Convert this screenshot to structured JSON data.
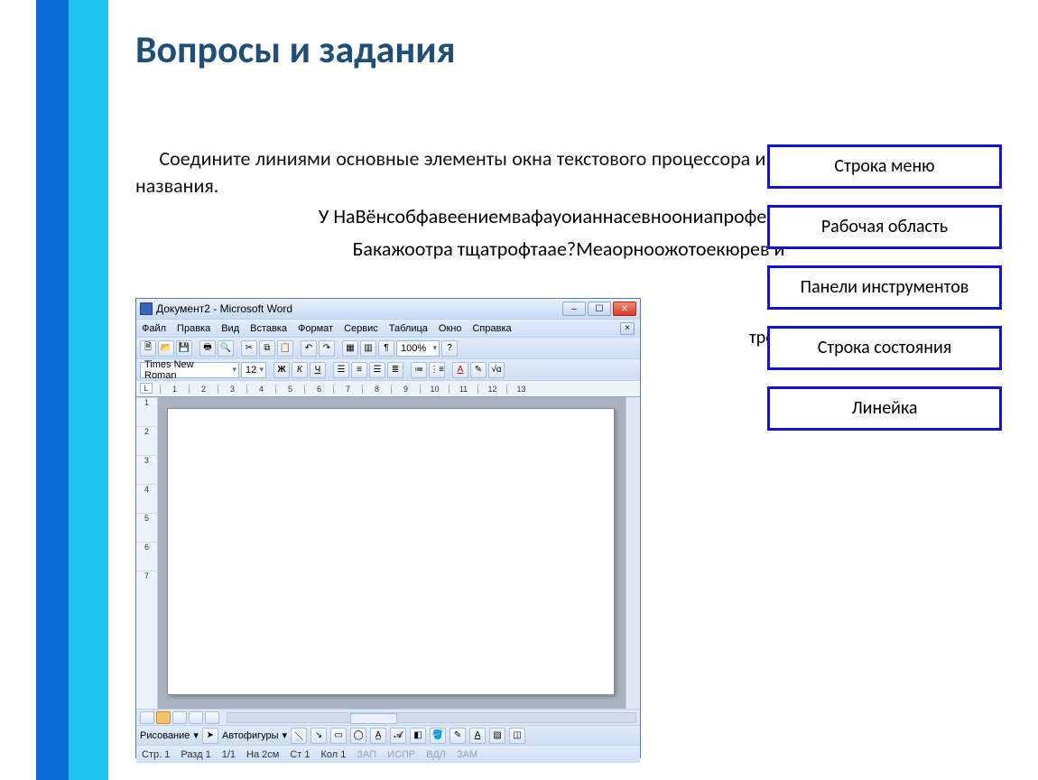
{
  "title": "Вопросы и задания",
  "intro": "Соедините линиями основные элементы окна текстового процессора и соответствующие им названия.",
  "garbled": {
    "line1": "У НаВёнсобфавеениемвафауоианнасевноониапрофеофа?и",
    "line2": "Бакажоотра тщатрофтаае?Меаорноожотоекюрев й"
  },
  "overlay_right": "треи?ссором?аголовка",
  "word": {
    "title": "Документ2 - Microsoft Word",
    "menu": [
      "Файл",
      "Правка",
      "Вид",
      "Вставка",
      "Формат",
      "Сервис",
      "Таблица",
      "Окно",
      "Справка"
    ],
    "zoom": "100%",
    "font_name": "Times New Roman",
    "font_size": "12",
    "ruler_marks": [
      "1",
      "2",
      "3",
      "4",
      "5",
      "6",
      "7",
      "8",
      "9",
      "10",
      "11",
      "12",
      "13"
    ],
    "vruler_marks": [
      "1",
      "2",
      "3",
      "4",
      "5",
      "6",
      "7"
    ],
    "drawbar": {
      "label": "Рисование",
      "autoshapes": "Автофигуры"
    },
    "status": {
      "page": "Стр. 1",
      "section": "Разд 1",
      "pages": "1/1",
      "at": "На 2см",
      "line": "Ст 1",
      "col": "Кол 1",
      "flags": [
        "ЗАП",
        "ИСПР",
        "ВДЛ",
        "ЗАМ"
      ]
    }
  },
  "labels": [
    "Строка меню",
    "Рабочая область",
    "Панели инструментов",
    "Строка состояния",
    "Линейка"
  ]
}
